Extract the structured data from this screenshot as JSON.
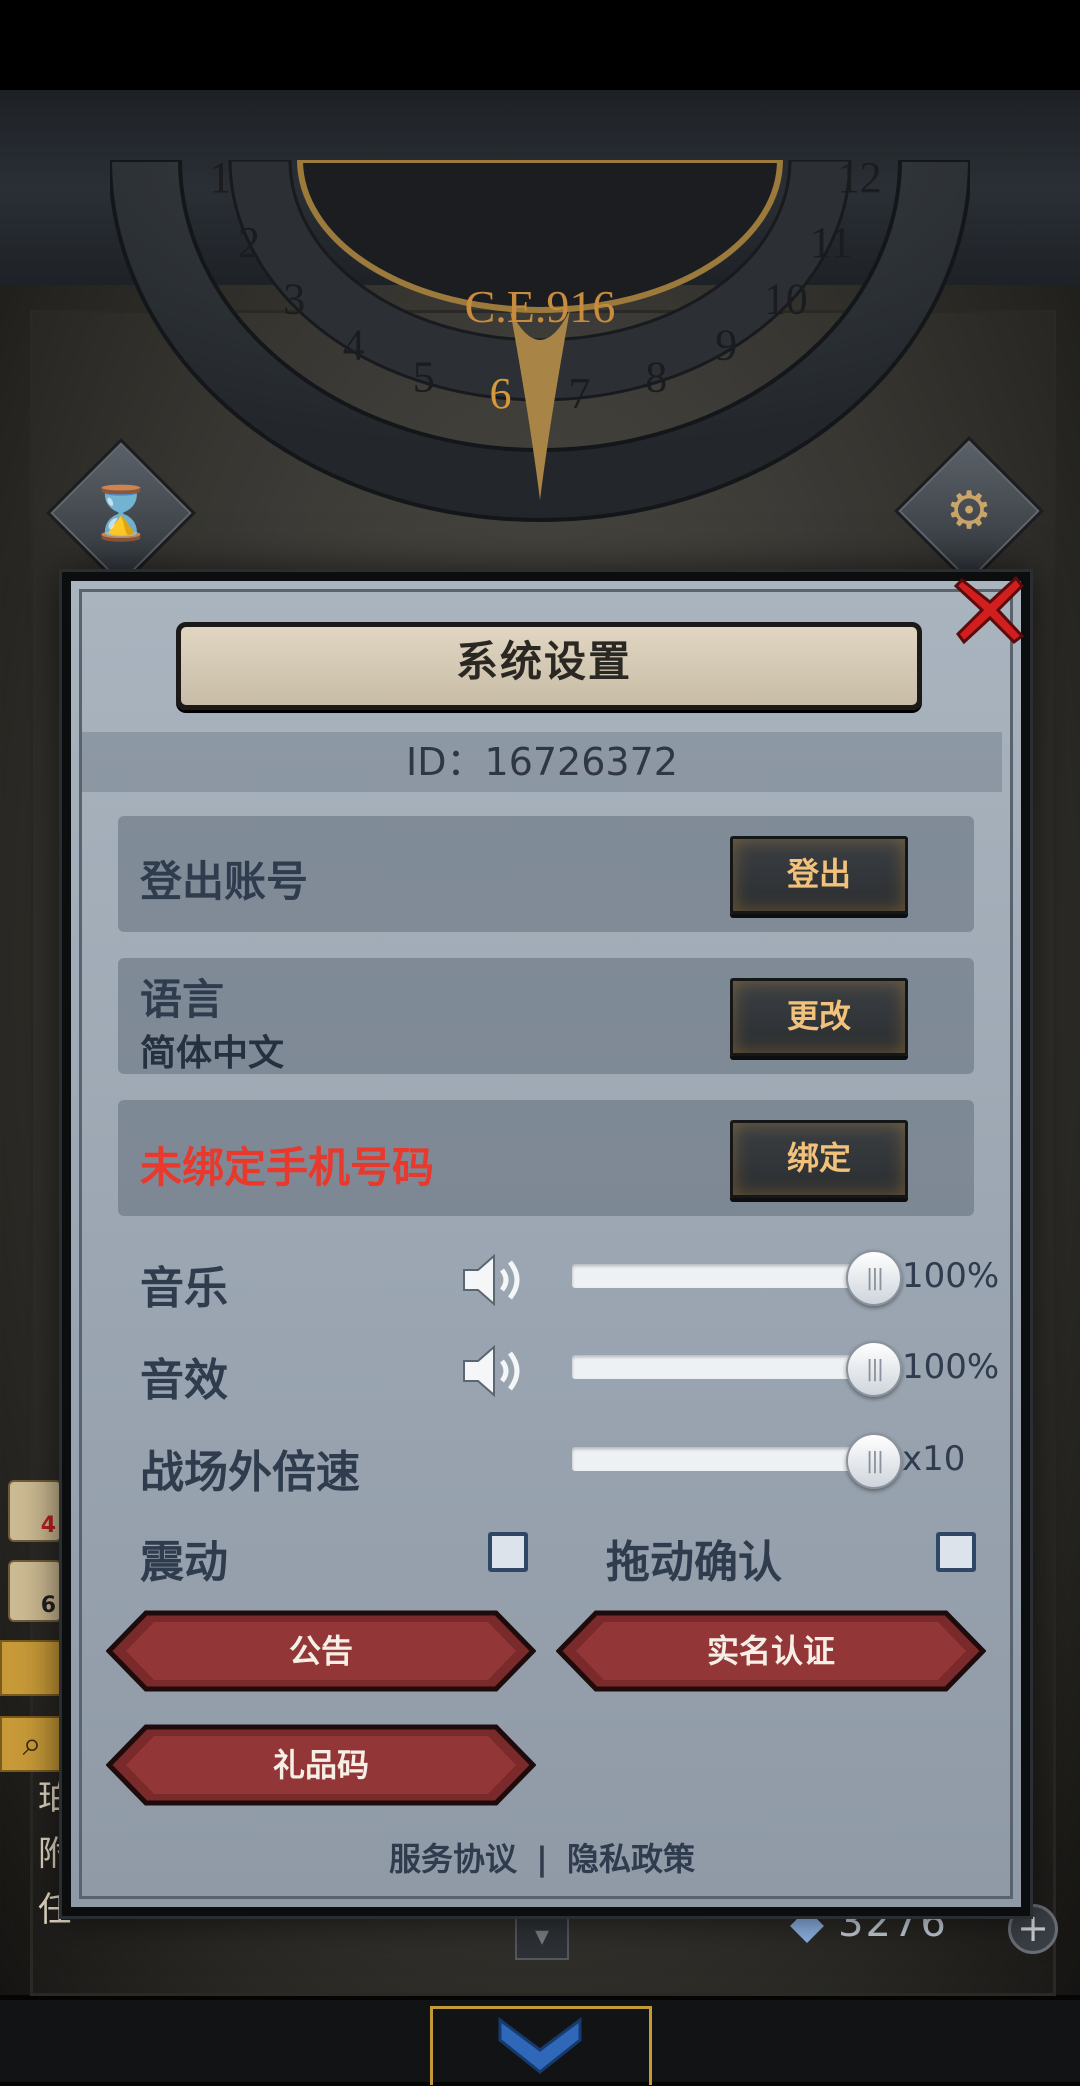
{
  "scene": {
    "era_label": "C.E.916",
    "dial_numbers": [
      "1",
      "2",
      "3",
      "4",
      "5",
      "6",
      "7",
      "8",
      "9",
      "10",
      "11",
      "12"
    ],
    "current_month": "6",
    "hourglass_icon": "hourglass-icon",
    "gear_icon": "gear-icon",
    "resource_count": "3276",
    "plus_label": "+",
    "side_letters": [
      "珀",
      "附",
      "任"
    ],
    "scroll_badges": [
      "4",
      "6"
    ]
  },
  "settings": {
    "title": "系统设置",
    "id_text": "ID：16726372",
    "logout": {
      "label": "登出账号",
      "button": "登出"
    },
    "language": {
      "label": "语言",
      "value": "简体中文",
      "button": "更改"
    },
    "phone": {
      "label": "未绑定手机号码",
      "button": "绑定"
    },
    "music": {
      "label": "音乐",
      "value_text": "100%",
      "level": 1.0
    },
    "sfx": {
      "label": "音效",
      "value_text": "100%",
      "level": 1.0
    },
    "speed": {
      "label": "战场外倍速",
      "value_text": "x10",
      "level": 1.0
    },
    "vibration": {
      "label": "震动",
      "checked": false
    },
    "drag_confirm": {
      "label": "拖动确认",
      "checked": false
    },
    "buttons": {
      "announcement": "公告",
      "realname": "实名认证",
      "giftcode": "礼品码"
    },
    "links": {
      "terms": "服务协议",
      "separator": "|",
      "privacy": "隐私政策"
    }
  },
  "colors": {
    "accent_gold": "#c49a37",
    "button_text": "#f2c27a",
    "warning_red": "#e8392c",
    "panel": "#9aa5b1"
  }
}
